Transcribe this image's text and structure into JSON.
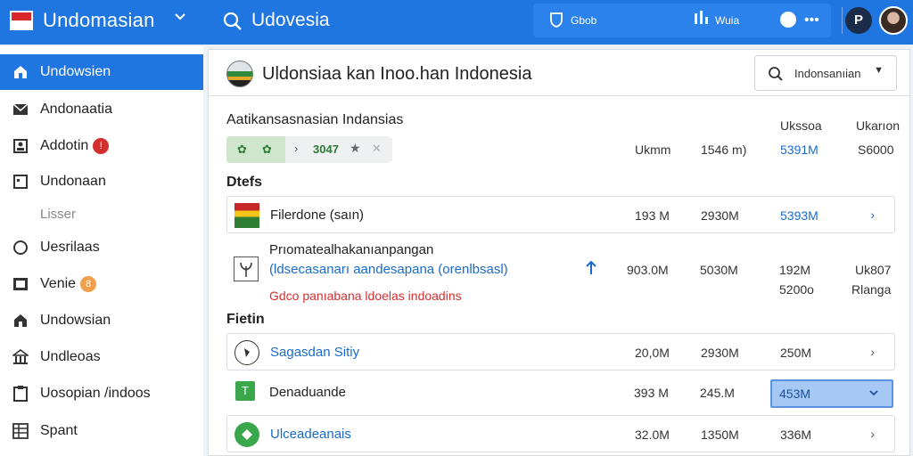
{
  "topbar": {
    "app_title": "Undomasian",
    "search_text": "Udovesia",
    "pill_label_1": "Gbob",
    "pill_label_2": "Wuia",
    "avatar_initial": "P",
    "accent_color": "#1f76e0"
  },
  "sidebar": {
    "items": [
      {
        "label": "Undowsien",
        "icon": "home-icon",
        "active": true
      },
      {
        "label": "Andonaatia",
        "icon": "mail-icon"
      },
      {
        "label": "Addotin",
        "icon": "contacts-icon",
        "badge": "!"
      },
      {
        "label": "Undonaan",
        "icon": "calendar-icon"
      },
      {
        "label": "Lisser",
        "icon": "none"
      },
      {
        "label": "Uesrilaas",
        "icon": "circle-icon"
      },
      {
        "label": "Venie",
        "icon": "image-icon",
        "badge": "8"
      },
      {
        "label": "Undowsian",
        "icon": "building-icon"
      },
      {
        "label": "Undleoas",
        "icon": "bank-icon"
      },
      {
        "label": "Uosopian /indoos",
        "icon": "clipboard-icon"
      },
      {
        "label": "Spant",
        "icon": "table-icon"
      }
    ]
  },
  "main": {
    "header_title": "Uldonsiaa kan Inoo.han Indonesia",
    "header_select": "Indonsanıian",
    "section_title": "Aatikansasnasian Indansias",
    "col_headers": [
      "Ukssoa",
      "Ukarıon"
    ],
    "summary": {
      "chip_count": "3047",
      "values": [
        "Ukmm",
        "1546 m)",
        "5391M",
        "S6000"
      ]
    },
    "group1_title": "Dtefs",
    "group2_title": "Fietin",
    "rows": [
      {
        "name": "Filerdone (saın)",
        "v1": "193 M",
        "v2": "2930M",
        "v3": "5393M",
        "icon": "flag-icon"
      },
      {
        "name": "Prıomatealhakanıanpangan",
        "sub": "(ldsecasanarı aandesapana (orenlbsasl)",
        "warn": "Gdco panıabana ldoelas indoadins",
        "v1": "903.0M",
        "v2": "5030M",
        "v3": "192M",
        "v3b": "5200o",
        "v4": "Uk807",
        "v4b": "Rlanga",
        "icon": "plant-icon"
      },
      {
        "name": "Sagasdan Sitiy",
        "v1": "20,0M",
        "v2": "2930M",
        "v3": "250M",
        "icon": "compass-icon"
      },
      {
        "name": "Denaduande",
        "v1": "393 M",
        "v2": "245.M",
        "v3": "453M",
        "icon": "green-square-icon"
      },
      {
        "name": "Ulceadeanais",
        "v1": "32.0M",
        "v2": "1350M",
        "v3": "336M",
        "icon": "green-circle-icon"
      }
    ]
  }
}
